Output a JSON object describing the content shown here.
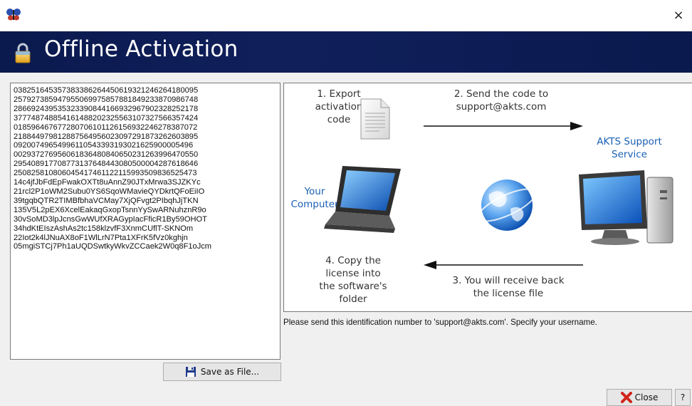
{
  "window": {
    "close_glyph": "×",
    "app_icon": "butterfly-icon"
  },
  "banner": {
    "title": "Offline Activation",
    "icon": "lock-icon"
  },
  "code_lines": [
    "038251645357383386264450619321246264180095",
    "257927385947955069975857881849233870986748",
    "286692439535323390844166932967902328252178",
    "377748748854161488202325563107327566357424",
    "018596467677280706101126156932246278387072",
    "218844979812887564956023097291873262603895",
    "092007496549961105433931930216259000054​96",
    "002937276956061836480840650231263996470550",
    "295408917708773137648443080500004287618646",
    "250825810806045417461122115993509836525473",
    "14c4jfJbFdEpFwakOXTt8uAnnZ90JTxMrwa3SJZKYc",
    "21rcl2P1oWM2Subu0YS6SqoWMavieQYDkrtQFoEiIO",
    "39tgqbQTR2TIMBfbhaVCMay7XjQFvgt2PIbqhJjTKN",
    "135V5L2pEX6XcelEakaqGxopTsnnYySwARNuhznR9o",
    "30vSoMD3lpJcnsGwWUfXRAGypIacFficR1By59OHOT",
    "34hdKtEIszAshAs2tc158klzvfF3XnmCUflT-SKNOm",
    "22Iot2k4lJNuAX8oF1WlLrN7Pta1XFrK5fVz0kghjn",
    "05mgiSTCj7Ph1aUQDSwtkyWkvZCCaek2W0q8F1oJcm"
  ],
  "save_button": {
    "label": "Save as File...",
    "icon": "floppy-disk-icon"
  },
  "diagram": {
    "step1": [
      "1. Export",
      "activation",
      "code"
    ],
    "step2": [
      "2. Send the code to",
      "support@akts.com"
    ],
    "support": [
      "AKTS Support",
      "Service"
    ],
    "computer": [
      "Your",
      "Computer"
    ],
    "step3": [
      "3. You will receive back",
      "the license file"
    ],
    "step4": [
      "4. Copy the",
      "license into",
      "the software's",
      "folder"
    ],
    "colors": {
      "blue_label": "#1a5fb4",
      "banner_bg": "#0a1a4e"
    }
  },
  "info_text": "Please send this identification number to 'support@akts.com'. Specify your username.",
  "close_button": {
    "label": "Close",
    "icon": "red-x-icon"
  },
  "help_button": {
    "label": "?"
  }
}
